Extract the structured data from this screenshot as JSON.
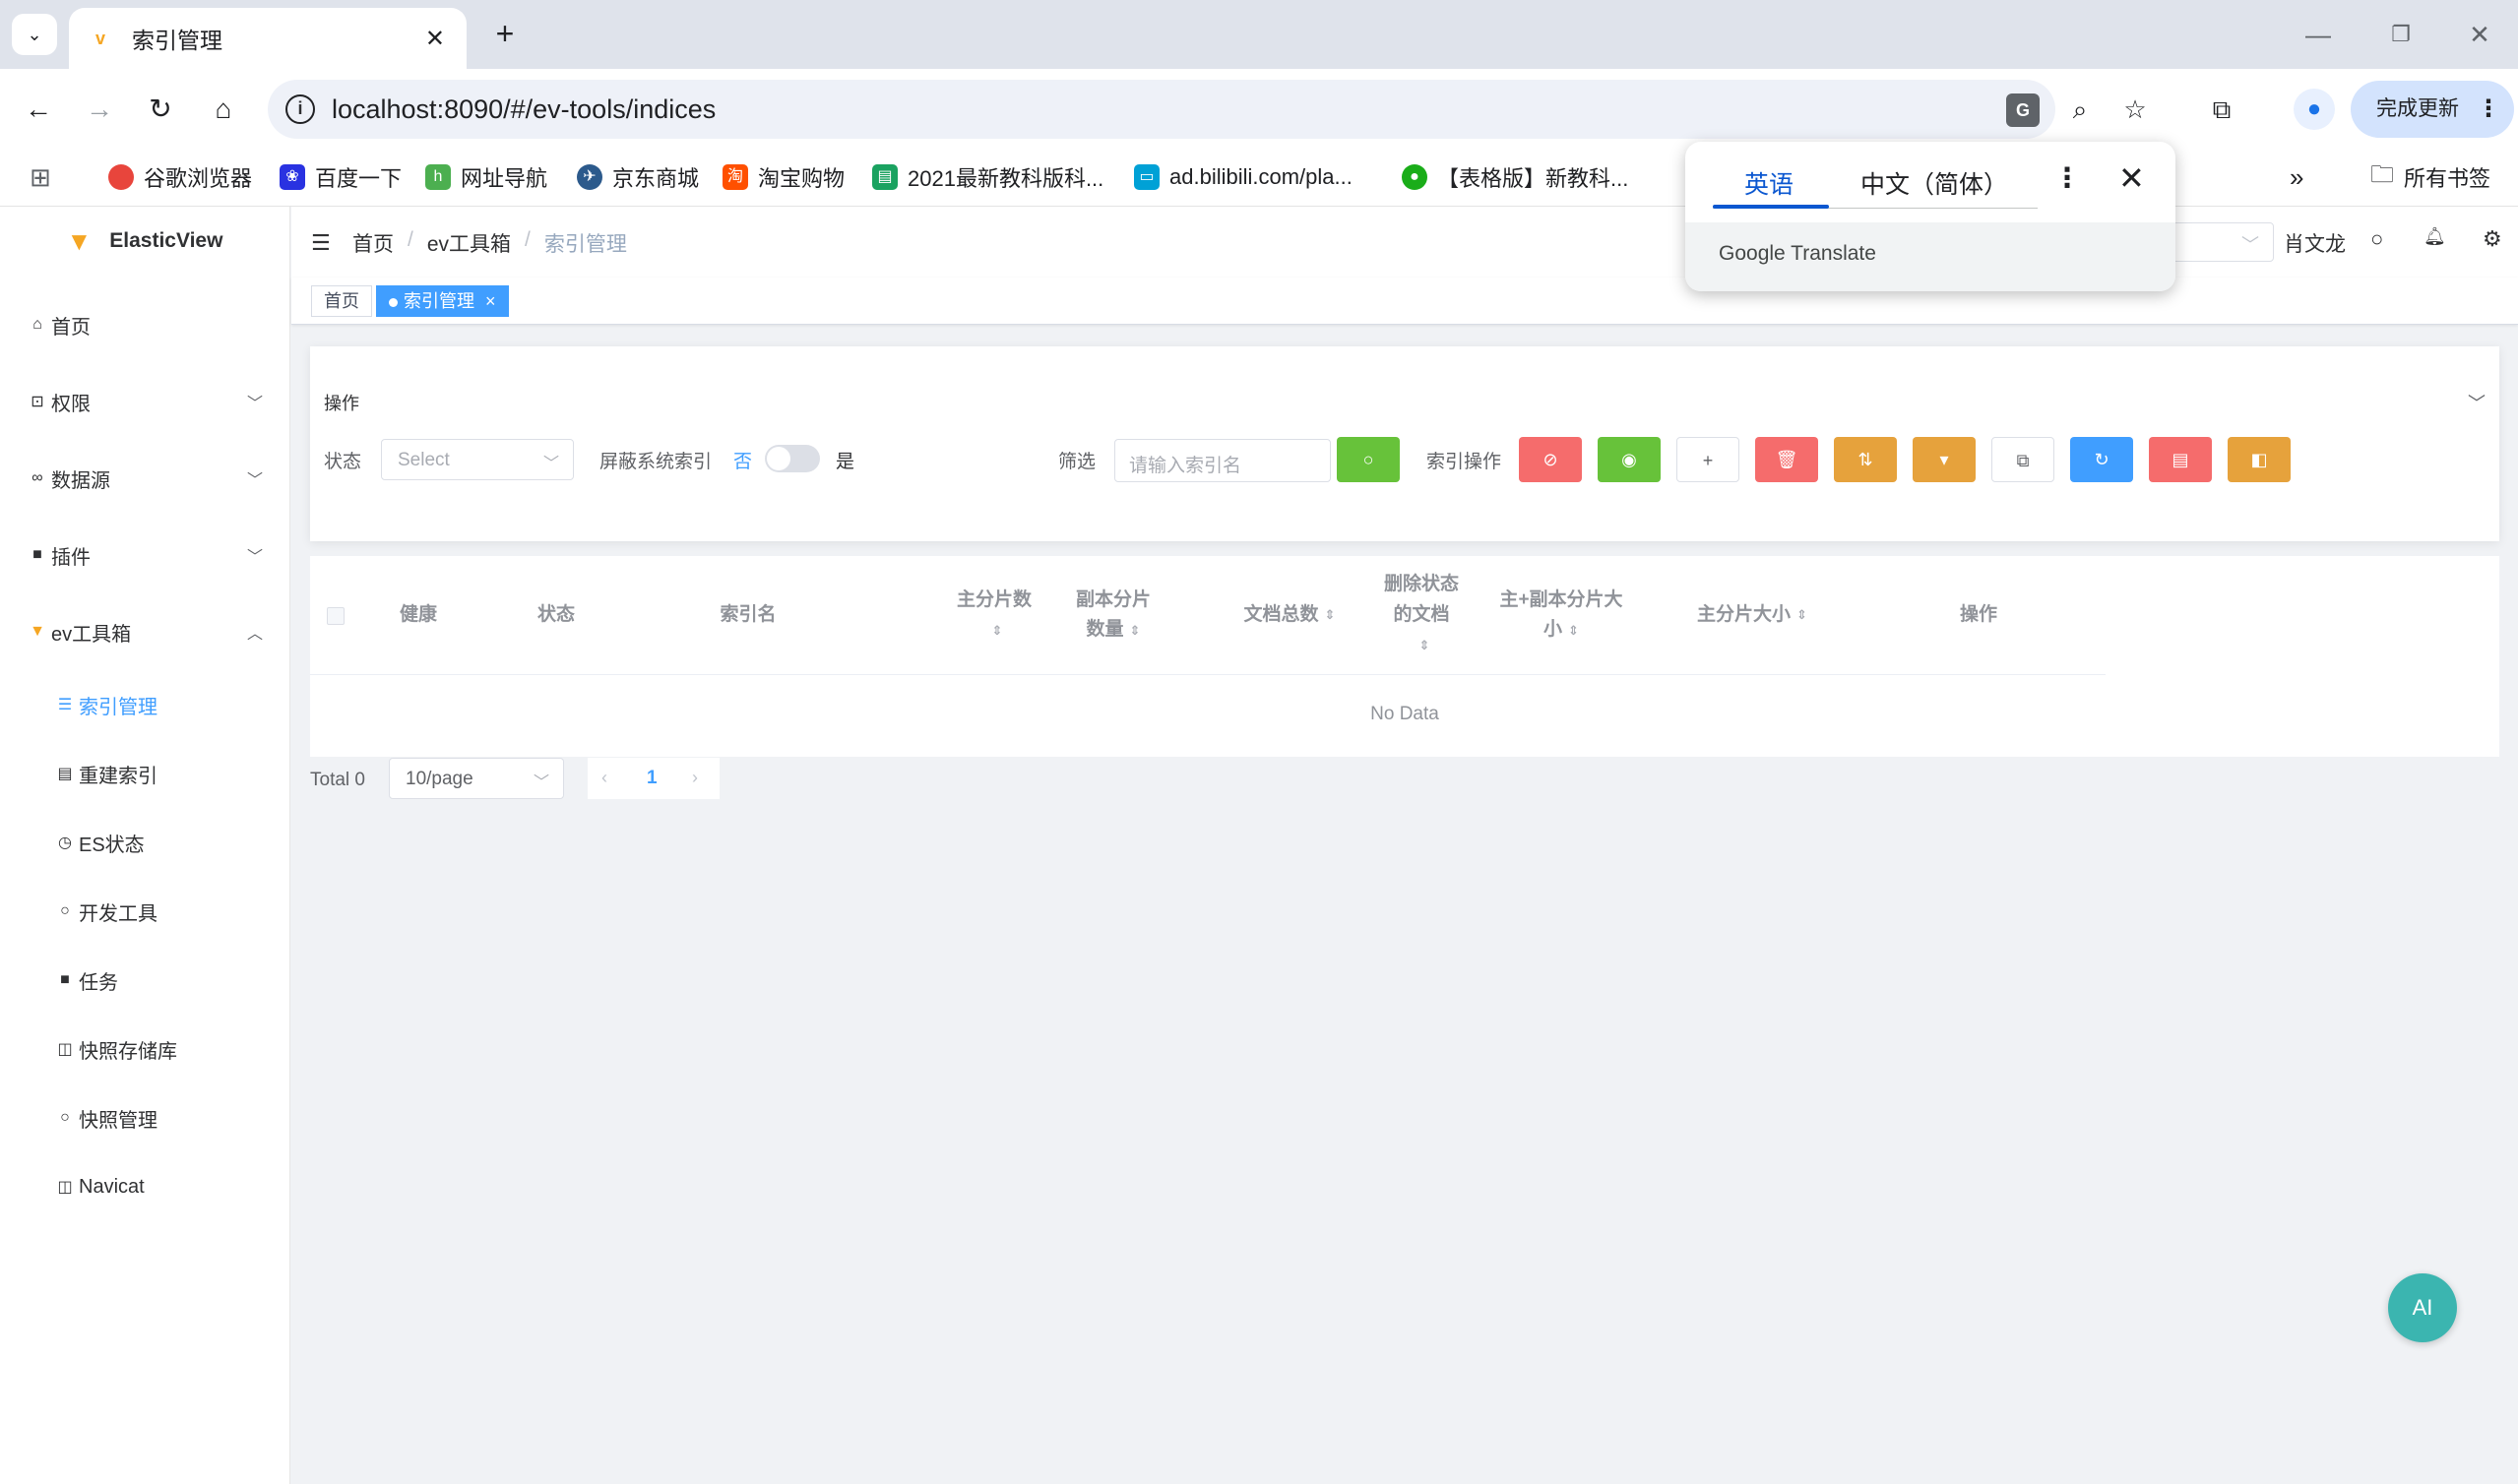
{
  "browser": {
    "tab_title": "索引管理",
    "url": "localhost:8090/#/ev-tools/indices",
    "update_label": "完成更新",
    "bookmarks": [
      {
        "label": "谷歌浏览器",
        "color": "#e8453c"
      },
      {
        "label": "百度一下",
        "color": "#2932e1"
      },
      {
        "label": "网址导航",
        "color": "#4caf50"
      },
      {
        "label": "京东商城",
        "color": "#2c5a8c"
      },
      {
        "label": "淘宝购物",
        "color": "#ff5000"
      },
      {
        "label": "2021最新教科版科...",
        "color": "#1aa260"
      },
      {
        "label": "ad.bilibili.com/pla...",
        "color": "#00a1d6"
      },
      {
        "label": "【表格版】新教科...",
        "color": "#1aad19"
      }
    ],
    "all_bookmarks_label": "所有书签"
  },
  "translate_popup": {
    "tab_source": "英语",
    "tab_target": "中文（简体）",
    "footer": "Google Translate"
  },
  "app": {
    "name": "ElasticView",
    "sidebar": {
      "items": [
        {
          "label": "首页",
          "icon": "home-icon",
          "glyph": "⌂"
        },
        {
          "label": "权限",
          "icon": "lock-icon",
          "glyph": "⊡"
        },
        {
          "label": "数据源",
          "icon": "link-icon",
          "glyph": "∞"
        },
        {
          "label": "插件",
          "icon": "plugin-icon",
          "glyph": "■"
        },
        {
          "label": "ev工具箱",
          "icon": "toolbox-icon",
          "glyph": "▼"
        }
      ],
      "sub_items": [
        {
          "label": "索引管理",
          "icon": "database-icon",
          "glyph": "☰"
        },
        {
          "label": "重建索引",
          "icon": "document-icon",
          "glyph": "▤"
        },
        {
          "label": "ES状态",
          "icon": "clock-icon",
          "glyph": "◷"
        },
        {
          "label": "开发工具",
          "icon": "search-icon",
          "glyph": "○"
        },
        {
          "label": "任务",
          "icon": "video-icon",
          "glyph": "■"
        },
        {
          "label": "快照存储库",
          "icon": "box-icon",
          "glyph": "◫"
        },
        {
          "label": "快照管理",
          "icon": "search-icon",
          "glyph": "○"
        },
        {
          "label": "Navicat",
          "icon": "box-icon",
          "glyph": "◫"
        }
      ]
    },
    "header": {
      "breadcrumb": [
        "首页",
        "ev工具箱",
        "索引管理"
      ],
      "user": "肖文龙"
    },
    "tags": {
      "home": "首页",
      "current": "索引管理"
    },
    "ops": {
      "title": "操作",
      "status_label": "状态",
      "status_placeholder": "Select",
      "hide_system_label": "屏蔽系统索引",
      "switch_no": "否",
      "switch_yes": "是",
      "switch_on": false,
      "filter_label": "筛选",
      "filter_placeholder": "请输入索引名",
      "index_ops_label": "索引操作"
    },
    "table": {
      "columns": [
        {
          "label": "健康",
          "sortable": false
        },
        {
          "label": "状态",
          "sortable": false
        },
        {
          "label": "索引名",
          "sortable": false
        },
        {
          "label": "主分片数",
          "sortable": true
        },
        {
          "label": "副本分片数量",
          "sortable": true
        },
        {
          "label": "文档总数",
          "sortable": true
        },
        {
          "label": "删除状态的文档",
          "sortable": true
        },
        {
          "label": "主+副本分片大小",
          "sortable": true
        },
        {
          "label": "主分片大小",
          "sortable": true
        },
        {
          "label": "操作",
          "sortable": false
        }
      ],
      "empty_text": "No Data"
    },
    "pagination": {
      "total": "Total 0",
      "page_size": "10/page",
      "current_page": "1"
    },
    "ai_button": "AI"
  }
}
